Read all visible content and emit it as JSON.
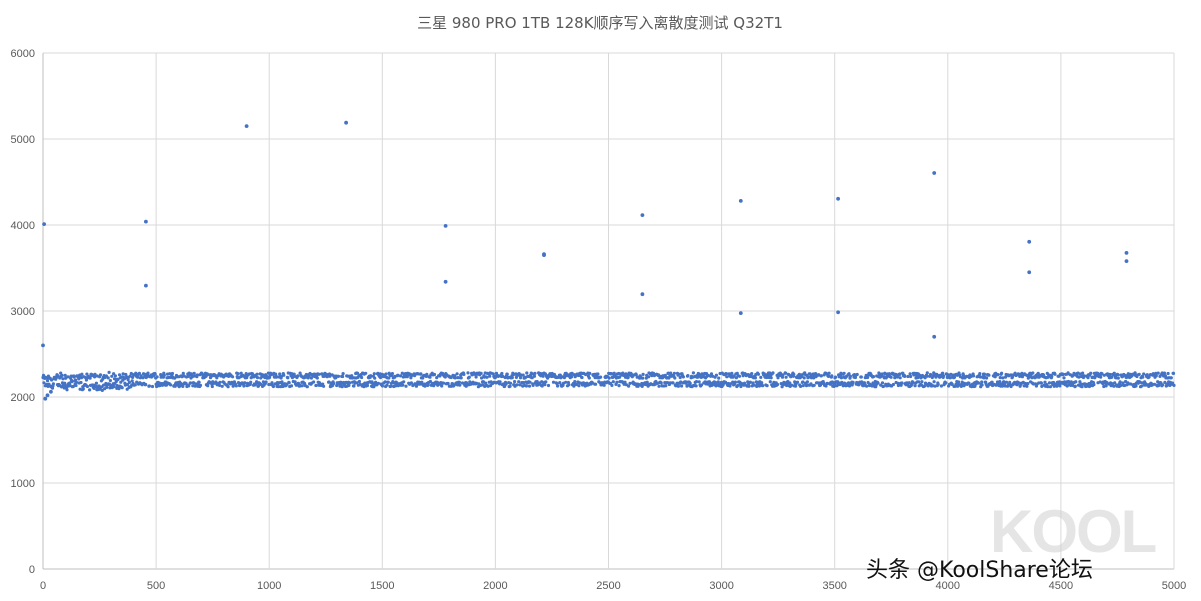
{
  "chart_data": {
    "type": "scatter",
    "title": "三星 980 PRO 1TB 128K顺序写入离散度测试 Q32T1",
    "xlabel": "",
    "ylabel": "",
    "xlim": [
      0,
      5000
    ],
    "ylim": [
      0,
      6000
    ],
    "x_ticks": [
      0,
      500,
      1000,
      1500,
      2000,
      2500,
      3000,
      3500,
      4000,
      4500,
      5000
    ],
    "y_ticks": [
      0,
      1000,
      2000,
      3000,
      4000,
      5000,
      6000
    ],
    "grid": true,
    "legend": "none",
    "marker_color": "#4472c4",
    "series": [
      {
        "description": "dense band of samples 0-5000, bands near 2150 and 2250 MB/s",
        "band": {
          "x_range": [
            0,
            5000
          ],
          "lower_band": 2150,
          "upper_band": 2250,
          "spread": 30,
          "count": 2500
        }
      },
      {
        "outliers": [
          {
            "x": 0,
            "y": 2600
          },
          {
            "x": 5,
            "y": 4010
          },
          {
            "x": 455,
            "y": 4040
          },
          {
            "x": 455,
            "y": 3295
          },
          {
            "x": 900,
            "y": 5150
          },
          {
            "x": 1340,
            "y": 5190
          },
          {
            "x": 1780,
            "y": 3990
          },
          {
            "x": 1780,
            "y": 3340
          },
          {
            "x": 2215,
            "y": 3650
          },
          {
            "x": 2215,
            "y": 3660
          },
          {
            "x": 2650,
            "y": 4115
          },
          {
            "x": 2650,
            "y": 3195
          },
          {
            "x": 3085,
            "y": 4280
          },
          {
            "x": 3085,
            "y": 2975
          },
          {
            "x": 3515,
            "y": 4305
          },
          {
            "x": 3515,
            "y": 2985
          },
          {
            "x": 3940,
            "y": 4605
          },
          {
            "x": 3940,
            "y": 2700
          },
          {
            "x": 4360,
            "y": 3805
          },
          {
            "x": 4360,
            "y": 3450
          },
          {
            "x": 4790,
            "y": 3675
          },
          {
            "x": 4790,
            "y": 3580
          },
          {
            "x": 10,
            "y": 1980
          },
          {
            "x": 20,
            "y": 2020
          },
          {
            "x": 35,
            "y": 2060
          }
        ]
      }
    ]
  },
  "watermark": {
    "logo_text": "KOOL",
    "caption": "头条 @KoolShare论坛"
  }
}
